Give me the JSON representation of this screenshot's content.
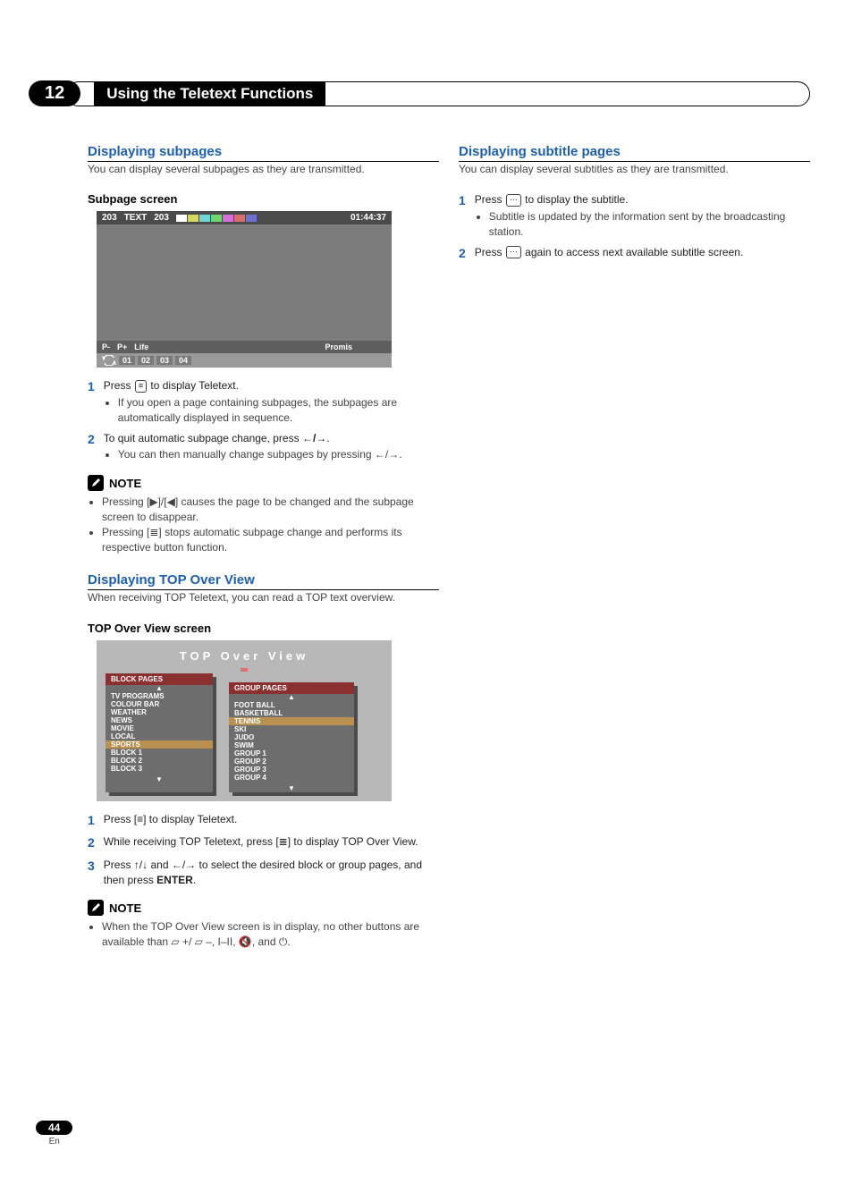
{
  "chapter": {
    "num": "12",
    "title": "Using the Teletext Functions"
  },
  "left": {
    "h_subpages": "Displaying subpages",
    "p_subpages": "You can display several subpages as they are transmitted.",
    "h_subscreen": "Subpage screen",
    "ttxt": {
      "pg1": "203",
      "txt": "TEXT",
      "pg2": "203",
      "time": "01:44:37",
      "pminus": "P-",
      "pplus": "P+",
      "life": "Life",
      "promis": "Promis",
      "subs": [
        "01",
        "02",
        "03",
        "04"
      ]
    },
    "steps1": [
      {
        "n": "1",
        "main": "Press ",
        "iconAfter": "teletext-icon",
        "tail": " to display Teletext.",
        "subs": [
          "If you open a page containing subpages, the subpages are automatically displayed in sequence."
        ]
      },
      {
        "n": "2",
        "main": "To quit automatic subpage change, press ",
        "arrows": "lr",
        "tail": ".",
        "subs": [
          "You can then manually change subpages by pressing ←/→."
        ]
      }
    ],
    "note1": [
      "Pressing [▶]/[◀] causes the page to be changed and the subpage screen to disappear.",
      "Pressing [≣] stops automatic subpage change and performs its respective button function."
    ],
    "h_top": "Displaying TOP Over View",
    "p_top": "When receiving TOP Teletext, you can read a TOP text overview.",
    "h_topscreen": "TOP Over View screen",
    "top": {
      "title": "TOP Over View",
      "block_h": "BLOCK PAGES",
      "group_h": "GROUP PAGES",
      "blocks": [
        "TV PROGRAMS",
        "COLOUR BAR",
        "WEATHER",
        "NEWS",
        "MOVIE",
        "LOCAL",
        "SPORTS",
        "BLOCK 1",
        "BLOCK 2",
        "BLOCK 3"
      ],
      "block_hi": 6,
      "groups": [
        "FOOT BALL",
        "BASKETBALL",
        "TENNIS",
        "SKI",
        "JUDO",
        "SWIM",
        "GROUP 1",
        "GROUP 2",
        "GROUP 3",
        "GROUP 4"
      ],
      "group_hi": 2
    },
    "steps2": [
      {
        "n": "1",
        "text": "Press [≡] to display Teletext."
      },
      {
        "n": "2",
        "text": "While receiving TOP Teletext, press [≣] to display TOP Over View."
      },
      {
        "n": "3",
        "text": "Press ↑/↓ and ←/→ to select the desired block or group pages, and then press ",
        "bold": "ENTER",
        "tail": "."
      }
    ],
    "note2": "When the TOP Over View screen is in display, no other buttons are available than  ▱ +/ ▱ –,  I–II,  🔇, and  ⏻."
  },
  "right": {
    "h_subtitle": "Displaying subtitle pages",
    "p_subtitle": "You can display several subtitles as they are transmitted.",
    "steps": [
      {
        "n": "1",
        "main": "Press ",
        "iconAfter": "subtitle-icon",
        "tail": " to display the subtitle.",
        "subs": [
          "Subtitle is updated by the information sent by the broadcasting station."
        ]
      },
      {
        "n": "2",
        "main": "Press ",
        "iconAfter": "subtitle-icon",
        "tail": " again to access next available subtitle screen."
      }
    ]
  },
  "page": {
    "num": "44",
    "lang": "En"
  }
}
